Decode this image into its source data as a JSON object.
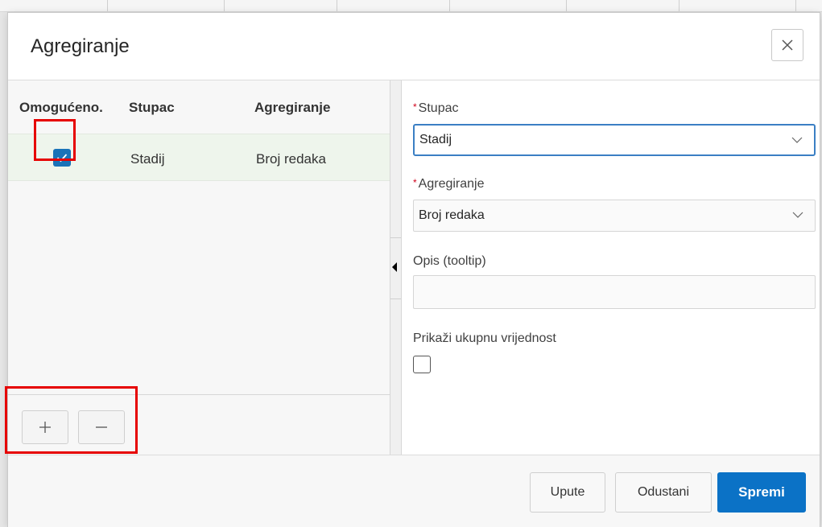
{
  "dialog": {
    "title": "Agregiranje",
    "close_icon": "close-icon"
  },
  "list": {
    "headers": [
      "Omogućeno.",
      "Stupac",
      "Agregiranje"
    ],
    "rows": [
      {
        "enabled": true,
        "column": "Stadij",
        "aggregation": "Broj redaka"
      }
    ],
    "add_icon": "plus-icon",
    "remove_icon": "minus-icon"
  },
  "form": {
    "column_label": "Stupac",
    "column_value": "Stadij",
    "aggregation_label": "Agregiranje",
    "aggregation_value": "Broj redaka",
    "tooltip_label": "Opis (tooltip)",
    "tooltip_value": "",
    "show_total_label": "Prikaži ukupnu vrijednost",
    "show_total_checked": false,
    "required_mark": "*"
  },
  "footer": {
    "help_label": "Upute",
    "cancel_label": "Odustani",
    "save_label": "Spremi"
  },
  "colors": {
    "primary": "#0b72c6",
    "highlight": "#e60000",
    "selected_row": "#eef5ec"
  }
}
